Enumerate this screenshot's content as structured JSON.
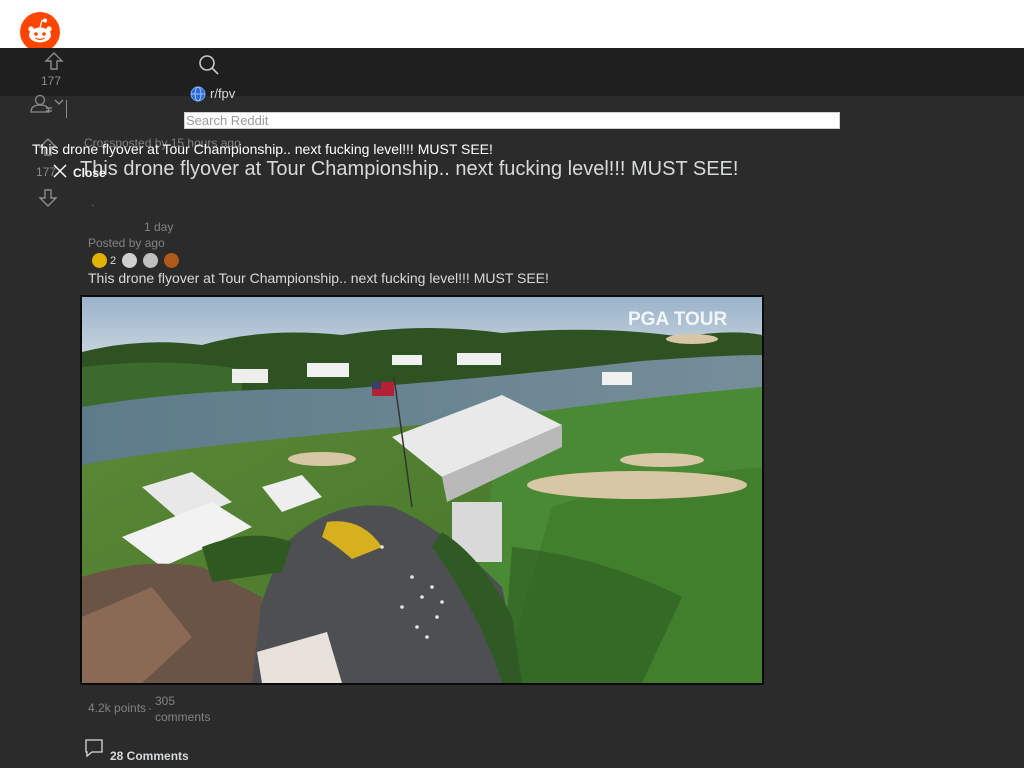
{
  "header": {
    "logo_icon": "reddit-alien-icon",
    "search_icon": "search-icon",
    "search_placeholder": "Search Reddit",
    "subreddit": "r/fpv",
    "accent": "#ff4500"
  },
  "vote_top": {
    "upvote_icon": "upvote-arrow-icon",
    "count": "177"
  },
  "vote_post": {
    "upvote_icon": "upvote-arrow-icon",
    "count": "177",
    "downvote_icon": "downvote-arrow-icon"
  },
  "user_menu_icon": "user-dropdown-icon",
  "overlay": {
    "title": "This drone flyover at Tour Championship.. next fucking level!!! MUST SEE!",
    "close_label": "Close"
  },
  "post": {
    "crosspost": "Crossposted by 15 hours ago",
    "title": "This drone flyover at Tour Championship.. next fucking level!!! MUST SEE!",
    "time": "1 day",
    "posted_by": "Posted by",
    "ago": "ago",
    "award_count": "2",
    "title_repeat": "This drone flyover at Tour Championship.. next fucking level!!! MUST SEE!",
    "media_watermark": "PGA TOUR",
    "points": "4.2k points",
    "comments_stat": "305 comments",
    "comments_button": "28 Comments"
  }
}
